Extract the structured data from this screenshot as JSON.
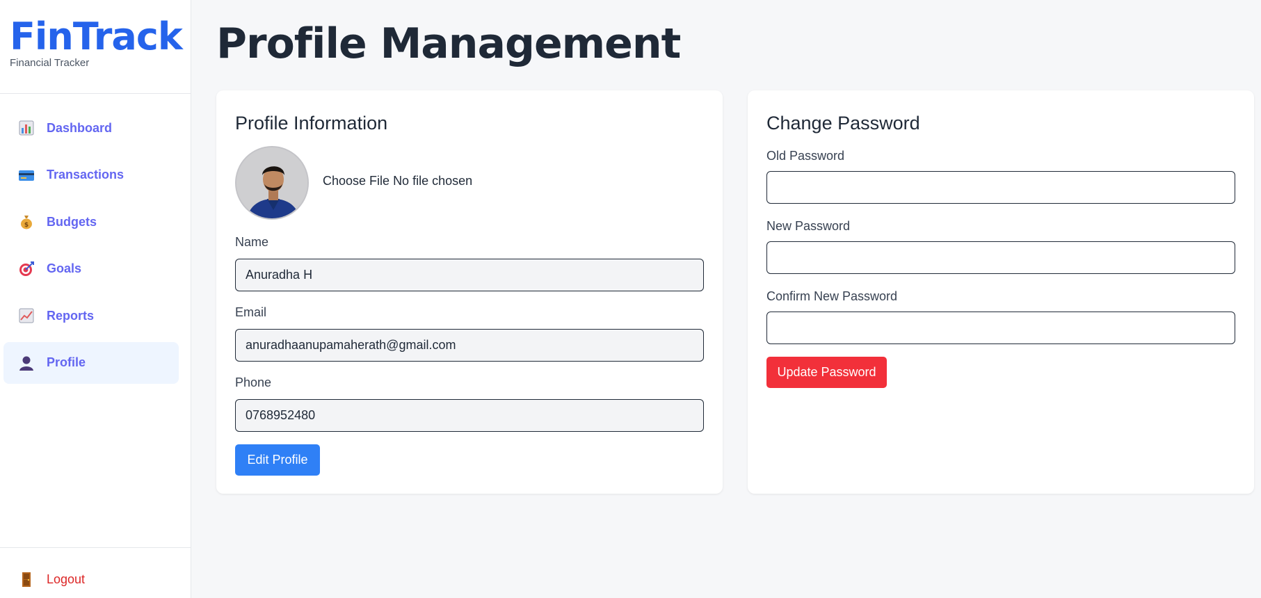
{
  "brand": {
    "name": "FinTrack",
    "subtitle": "Financial Tracker"
  },
  "nav": {
    "items": [
      {
        "label": "Dashboard",
        "icon": "bar-chart-icon",
        "active": false
      },
      {
        "label": "Transactions",
        "icon": "credit-card-icon",
        "active": false
      },
      {
        "label": "Budgets",
        "icon": "money-bag-icon",
        "active": false
      },
      {
        "label": "Goals",
        "icon": "target-icon",
        "active": false
      },
      {
        "label": "Reports",
        "icon": "trend-chart-icon",
        "active": false
      },
      {
        "label": "Profile",
        "icon": "user-silhouette-icon",
        "active": true
      }
    ],
    "logout": {
      "label": "Logout",
      "icon": "door-icon"
    }
  },
  "page": {
    "title": "Profile Management"
  },
  "profile": {
    "title": "Profile Information",
    "file_button": "Choose File",
    "file_status": "No file chosen",
    "name_label": "Name",
    "name_value": "Anuradha H",
    "email_label": "Email",
    "email_value": "anuradhaanupamaherath@gmail.com",
    "phone_label": "Phone",
    "phone_value": "0768952480",
    "edit_button": "Edit Profile"
  },
  "password": {
    "title": "Change Password",
    "old_label": "Old Password",
    "new_label": "New Password",
    "confirm_label": "Confirm New Password",
    "update_button": "Update Password"
  },
  "colors": {
    "brand": "#2563eb",
    "nav_text": "#6366f1",
    "active_bg": "#eef5ff",
    "primary_button": "#2f80f6",
    "danger_button": "#f2303a",
    "logout_text": "#dc2626"
  }
}
